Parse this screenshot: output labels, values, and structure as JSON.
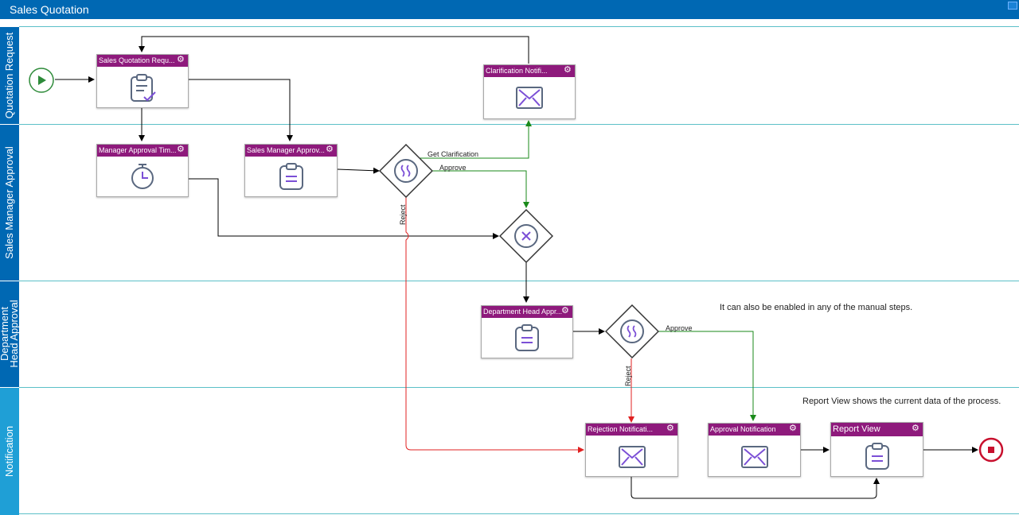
{
  "window": {
    "title": "Sales Quotation"
  },
  "lanes": [
    {
      "label": "Quotation Request"
    },
    {
      "label": "Sales Manager Approval"
    },
    {
      "label": "Department Head Approval"
    },
    {
      "label": "Notification"
    }
  ],
  "tasks": {
    "sales_quotation_request": {
      "label": "Sales Quotation Requ...",
      "icon": "clipboard-check-icon"
    },
    "clarification_notification": {
      "label": "Clarification Notifi...",
      "icon": "envelope-icon"
    },
    "manager_approval_timer": {
      "label": "Manager Approval Tim...",
      "icon": "stopwatch-icon"
    },
    "sales_manager_approval": {
      "label": "Sales Manager Approv...",
      "icon": "clipboard-list-icon"
    },
    "department_head_approval": {
      "label": "Department Head Appr...",
      "icon": "clipboard-list-icon"
    },
    "rejection_notification": {
      "label": "Rejection Notificati...",
      "icon": "envelope-icon"
    },
    "approval_notification": {
      "label": "Approval Notification",
      "icon": "envelope-icon"
    },
    "report_view": {
      "label": "Report View",
      "icon": "clipboard-list-icon"
    }
  },
  "flow_labels": {
    "get_clarification": "Get Clarification",
    "approve_1": "Approve",
    "reject_1": "Reject",
    "approve_2": "Approve",
    "reject_2": "Reject"
  },
  "notes": {
    "manual_steps": "It can also be enabled in any of the manual steps.",
    "report_view": "Report View shows the current data of the process."
  },
  "colors": {
    "header_blue": "#0068b3",
    "lane_blue_light": "#1f9fd6",
    "task_header": "#8e1a7c",
    "approve_flow": "#1a8a1a",
    "reject_flow": "#e02020",
    "start_event": "#2e8b3a",
    "end_event": "#c8102e",
    "icon_purple": "#7b4fd6"
  }
}
